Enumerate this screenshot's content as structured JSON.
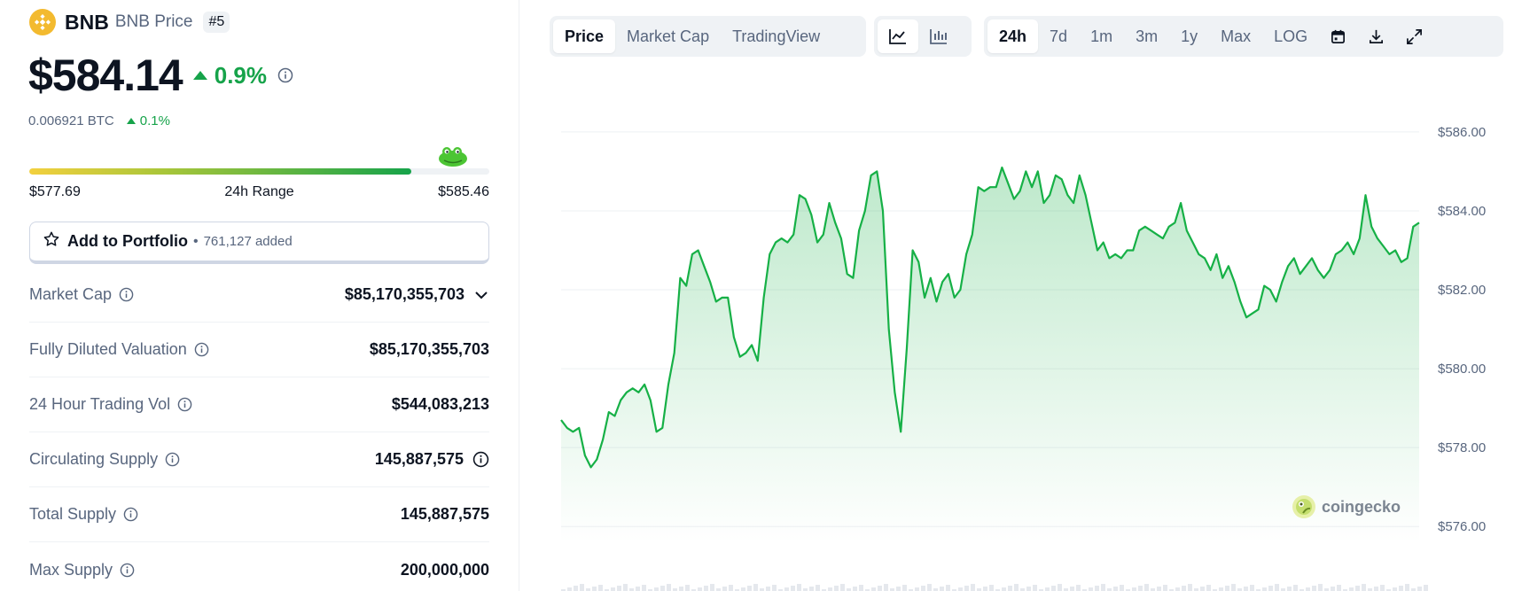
{
  "coin": {
    "symbol": "BNB",
    "name_suffix": "BNB Price",
    "rank": "#5",
    "price": "$584.14",
    "change_24h": "0.9%",
    "btc_price": "0.006921 BTC",
    "btc_change": "0.1%"
  },
  "range": {
    "low": "$577.69",
    "label": "24h Range",
    "high": "$585.46",
    "fill_fraction": 0.83
  },
  "portfolio": {
    "button_label": "Add to Portfolio",
    "added_count": "761,127 added"
  },
  "stats": [
    {
      "label": "Market Cap",
      "value": "$85,170,355,703",
      "trail": "chevron-down"
    },
    {
      "label": "Fully Diluted Valuation",
      "value": "$85,170,355,703"
    },
    {
      "label": "24 Hour Trading Vol",
      "value": "$544,083,213"
    },
    {
      "label": "Circulating Supply",
      "value": "145,887,575",
      "trail": "info"
    },
    {
      "label": "Total Supply",
      "value": "145,887,575"
    },
    {
      "label": "Max Supply",
      "value": "200,000,000"
    }
  ],
  "chart_tabs": {
    "type_tabs": [
      "Price",
      "Market Cap",
      "TradingView"
    ],
    "active_type": "Price",
    "time_tabs": [
      "24h",
      "7d",
      "1m",
      "3m",
      "1y",
      "Max",
      "LOG"
    ],
    "active_time": "24h"
  },
  "watermark": "coingecko",
  "colors": {
    "up": "#16a34a",
    "line": "#16b046",
    "brand": "#f3ba2f"
  },
  "chart_data": {
    "type": "area",
    "title": "",
    "xlabel": "",
    "ylabel": "",
    "ylim": [
      575.6,
      586.2
    ],
    "y_ticks": [
      "$586.00",
      "$584.00",
      "$582.00",
      "$580.00",
      "$578.00",
      "$576.00"
    ],
    "y_tick_values": [
      586,
      584,
      582,
      580,
      578,
      576
    ],
    "series": [
      {
        "values": [
          578.7,
          578.5,
          578.4,
          578.5,
          577.8,
          577.5,
          577.7,
          578.2,
          578.9,
          578.8,
          579.2,
          579.4,
          579.5,
          579.4,
          579.6,
          579.2,
          578.4,
          578.5,
          579.6,
          580.4,
          582.3,
          582.1,
          582.9,
          583.0,
          582.6,
          582.2,
          581.7,
          581.8,
          581.8,
          580.8,
          580.3,
          580.4,
          580.6,
          580.2,
          581.8,
          582.9,
          583.2,
          583.3,
          583.2,
          583.4,
          584.4,
          584.3,
          583.9,
          583.2,
          583.4,
          584.2,
          583.7,
          583.3,
          582.4,
          582.3,
          583.5,
          584.0,
          584.9,
          585.0,
          584.0,
          581.0,
          579.4,
          578.4,
          580.5,
          583.0,
          582.7,
          581.8,
          582.3,
          581.7,
          582.2,
          582.4,
          581.8,
          582.0,
          582.9,
          583.4,
          584.6,
          584.5,
          584.6,
          584.6,
          585.1,
          584.7,
          584.3,
          584.5,
          585.0,
          584.6,
          585.0,
          584.2,
          584.4,
          584.9,
          584.8,
          584.4,
          584.2,
          584.9,
          584.4,
          583.7,
          583.0,
          583.2,
          582.8,
          582.9,
          582.8,
          583.0,
          583.0,
          583.5,
          583.6,
          583.5,
          583.4,
          583.3,
          583.6,
          583.7,
          584.2,
          583.5,
          583.2,
          582.9,
          582.8,
          582.5,
          582.9,
          582.3,
          582.6,
          582.2,
          581.7,
          581.3,
          581.4,
          581.5,
          582.1,
          582.0,
          581.7,
          582.2,
          582.6,
          582.8,
          582.4,
          582.6,
          582.8,
          582.5,
          582.3,
          582.5,
          582.9,
          583.0,
          583.2,
          582.9,
          583.3,
          584.4,
          583.6,
          583.3,
          583.1,
          582.9,
          583.0,
          582.7,
          582.8,
          583.6,
          583.7
        ]
      }
    ]
  }
}
